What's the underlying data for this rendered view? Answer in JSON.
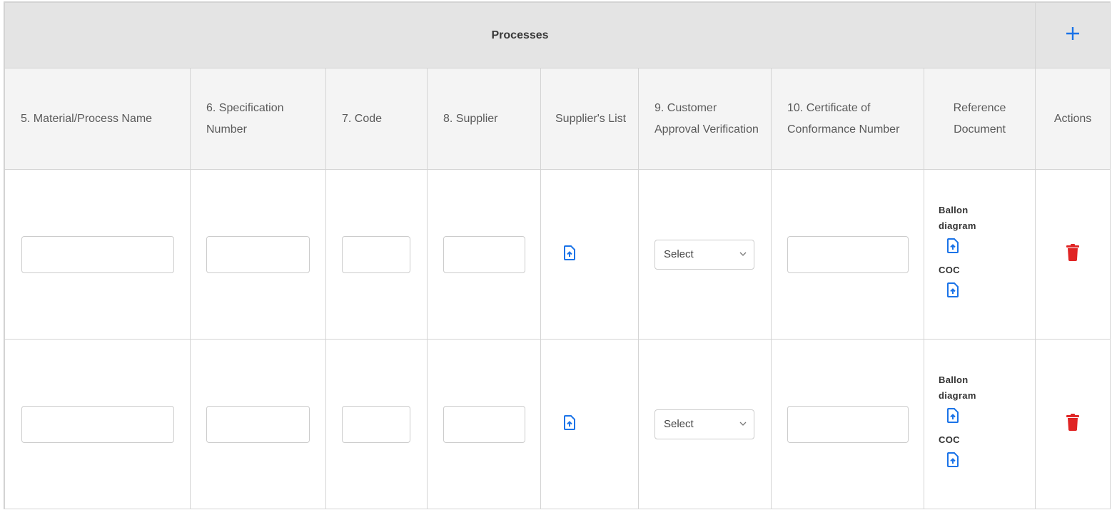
{
  "section": {
    "title": "Processes",
    "add_icon": "plus-icon",
    "accent_color": "#1a73e8"
  },
  "columns": [
    "5. Material/Process Name",
    "6. Specification Number",
    "7. Code",
    "8. Supplier",
    "Supplier's List",
    "9. Customer Approval Verification",
    "10. Certificate of Conformance Number",
    "Reference Document",
    "Actions"
  ],
  "rows": [
    {
      "material_name": "",
      "spec_number": "",
      "code": "",
      "supplier": "",
      "approval_selected": "Select",
      "coc_number": "",
      "ref_docs": [
        "Ballon diagram",
        "COC"
      ]
    },
    {
      "material_name": "",
      "spec_number": "",
      "code": "",
      "supplier": "",
      "approval_selected": "Select",
      "coc_number": "",
      "ref_docs": [
        "Ballon diagram",
        "COC"
      ]
    }
  ],
  "icons": {
    "upload": "file-upload-icon",
    "delete": "trash-icon",
    "dropdown": "chevron-down-icon"
  },
  "colors": {
    "upload_icon": "#1a73e8",
    "delete_icon": "#e02424",
    "title_bg": "#e4e4e4",
    "header_bg": "#f4f4f4"
  }
}
